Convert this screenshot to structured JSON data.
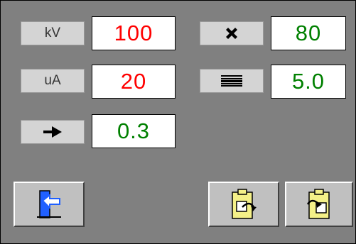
{
  "colors": {
    "panel_bg": "#808080",
    "label_bg": "#d4d4d4",
    "value_bg": "#ffffff",
    "red_value": "#ff0000",
    "green_value": "#008000",
    "button_bg": "#c0c0c0",
    "clipboard_yellow": "#f4f088",
    "exit_blue": "#2060ff"
  },
  "left_column": [
    {
      "label": "kV",
      "value": "100",
      "value_color": "#ff0000"
    },
    {
      "label": "uA",
      "value": "20",
      "value_color": "#ff0000"
    },
    {
      "label_icon": "arrow-right-icon",
      "value": "0.3",
      "value_color": "#008000"
    }
  ],
  "right_column": [
    {
      "label_icon": "cross-shape-icon",
      "value": "80",
      "value_color": "#008000"
    },
    {
      "label_icon": "horizontal-lines-icon",
      "value": "5.0",
      "value_color": "#008000"
    }
  ],
  "buttons": {
    "exit": {
      "icon": "exit-door-icon"
    },
    "paste_out": {
      "icon": "clipboard-export-icon"
    },
    "paste_in": {
      "icon": "clipboard-import-icon"
    }
  }
}
